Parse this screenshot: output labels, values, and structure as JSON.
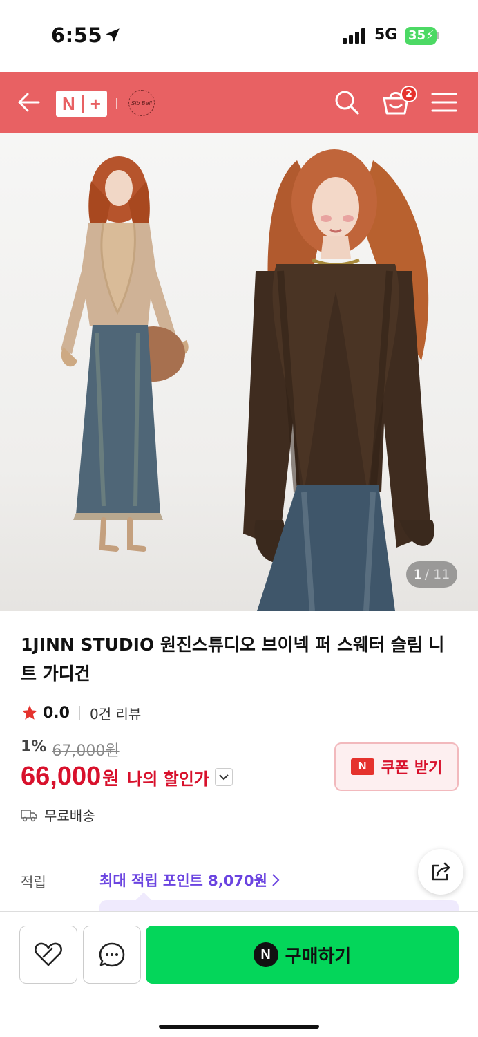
{
  "status_bar": {
    "time": "6:55",
    "network": "5G",
    "battery": "35"
  },
  "header": {
    "logo_text": "N+",
    "store_logo_text": "Sib Bell",
    "cart_count": "2",
    "color": "#e86163"
  },
  "gallery": {
    "current": "1",
    "total": "/ 11"
  },
  "product": {
    "title": "1JINN STUDIO 원진스튜디오 브이넥 퍼 스웨터 슬림 니트 가디건",
    "rating": "0.0",
    "review_count": "0건 리뷰",
    "discount_rate": "1%",
    "original_price": "67,000원",
    "sale_price": "66,000",
    "currency": "원",
    "my_price_label": "나의 할인가",
    "shipping": "무료배송"
  },
  "coupon": {
    "badge": "N",
    "label": "쿠폰 받기"
  },
  "points": {
    "label": "적립",
    "value": "최대 적립 포인트 8,070원"
  },
  "bottom_bar": {
    "buy_badge": "N",
    "buy_label": "구매하기"
  },
  "colors": {
    "accent_red": "#d8112c",
    "buy_green": "#04d65a",
    "points_purple": "#6a43e0"
  }
}
